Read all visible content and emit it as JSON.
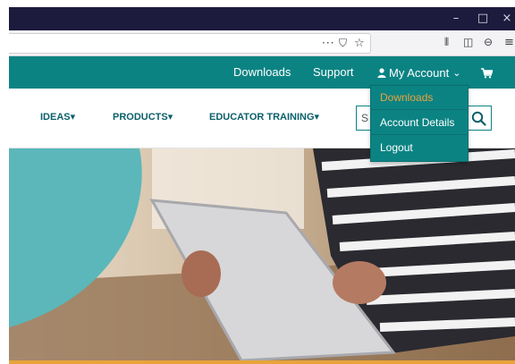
{
  "window": {
    "minimize_glyph": "–",
    "maximize_glyph": "□",
    "close_glyph": "×"
  },
  "toolbar": {
    "url_text": "",
    "icons": {
      "page_actions": "···",
      "pocket": "⛉",
      "bookmark": "☆",
      "library": "⫴",
      "sidebar": "◫",
      "account": "⊖",
      "menu": "≡"
    }
  },
  "topnav": {
    "downloads": "Downloads",
    "support": "Support",
    "account_icon": "person-icon",
    "my_account": "My Account",
    "chevron": "⌄",
    "cart_icon": "cart-icon"
  },
  "mainnav": {
    "ideas": "IDEAS",
    "products": "PRODUCTS",
    "educator_training": "EDUCATOR TRAINING",
    "caret": "▾",
    "search_value": "S"
  },
  "account_dropdown": {
    "items": [
      "Downloads",
      "Account Details",
      "Logout"
    ],
    "highlight_color": "#e8a33b"
  },
  "colors": {
    "teal": "#0c8383",
    "nav_text": "#0b5f6a",
    "accent_orange": "#e8a33b",
    "hero_teal_shape": "#5bb7ba",
    "titlebar": "#1c1b3d"
  }
}
